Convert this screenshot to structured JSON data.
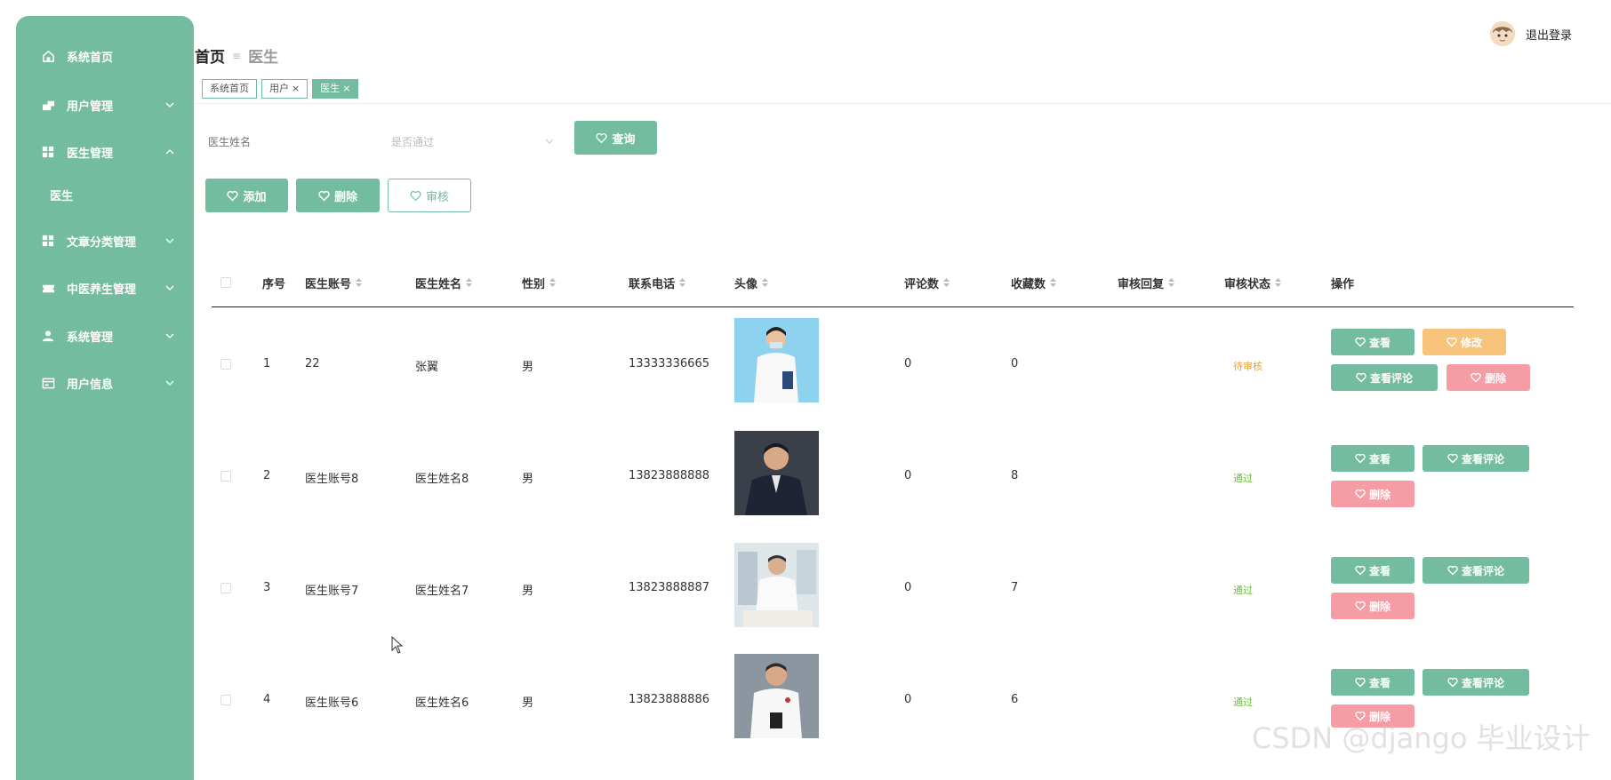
{
  "sidebar": {
    "items": [
      {
        "label": "系统首页",
        "icon": "home-icon"
      },
      {
        "label": "用户管理",
        "icon": "user-manage-icon"
      },
      {
        "label": "医生管理",
        "icon": "grid-icon"
      },
      {
        "label": "医生",
        "icon": ""
      },
      {
        "label": "文章分类管理",
        "icon": "grid-icon"
      },
      {
        "label": "中医养生管理",
        "icon": "ticket-icon"
      },
      {
        "label": "系统管理",
        "icon": "person-icon"
      },
      {
        "label": "用户信息",
        "icon": "card-icon"
      }
    ]
  },
  "header": {
    "logout": "退出登录"
  },
  "breadcrumb": {
    "home": "首页",
    "sep": "≡",
    "current": "医生"
  },
  "tags": [
    {
      "label": "系统首页",
      "close": ""
    },
    {
      "label": "用户",
      "close": "×"
    },
    {
      "label": "医生",
      "close": "×"
    }
  ],
  "search": {
    "name_placeholder": "医生姓名",
    "pass_placeholder": "是否通过",
    "query_label": "查询"
  },
  "toolbar": {
    "add": "添加",
    "delete": "删除",
    "audit": "审核"
  },
  "table": {
    "headers": [
      "序号",
      "医生账号",
      "医生姓名",
      "性别",
      "联系电话",
      "头像",
      "评论数",
      "收藏数",
      "审核回复",
      "审核状态",
      "操作"
    ],
    "rows": [
      {
        "no": "1",
        "account": "22",
        "name": "张翼",
        "gender": "男",
        "phone": "13333336665",
        "comments": "0",
        "favorites": "0",
        "reply": "",
        "status": "待审核",
        "status_type": "pending"
      },
      {
        "no": "2",
        "account": "医生账号8",
        "name": "医生姓名8",
        "gender": "男",
        "phone": "13823888888",
        "comments": "0",
        "favorites": "8",
        "reply": "",
        "status": "通过",
        "status_type": "ok"
      },
      {
        "no": "3",
        "account": "医生账号7",
        "name": "医生姓名7",
        "gender": "男",
        "phone": "13823888887",
        "comments": "0",
        "favorites": "7",
        "reply": "",
        "status": "通过",
        "status_type": "ok"
      },
      {
        "no": "4",
        "account": "医生账号6",
        "name": "医生姓名6",
        "gender": "男",
        "phone": "13823888886",
        "comments": "0",
        "favorites": "6",
        "reply": "",
        "status": "通过",
        "status_type": "ok"
      }
    ],
    "actions": {
      "view": "查看",
      "edit": "修改",
      "view_comments": "查看评论",
      "delete": "删除"
    }
  },
  "watermark": "CSDN @django 毕业设计",
  "colors": {
    "primary": "#74bc9f",
    "edit": "#f8c47c",
    "delete": "#f59ca5",
    "pending": "#e6a23c",
    "ok": "#67c23a"
  }
}
